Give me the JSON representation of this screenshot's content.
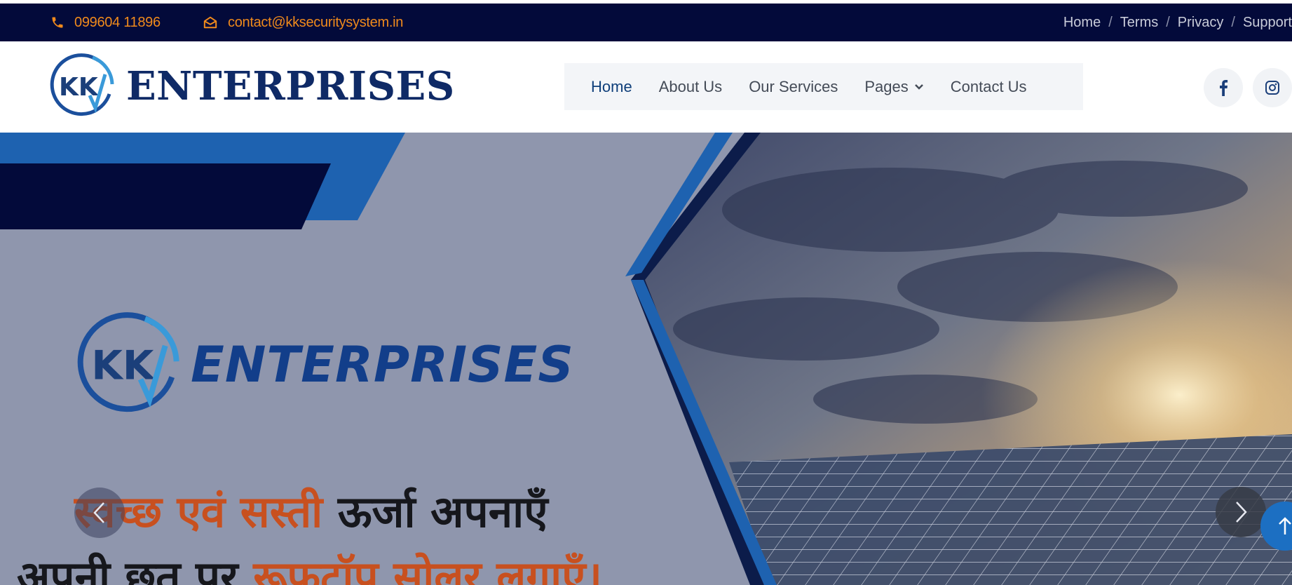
{
  "topbar": {
    "phone": "099604 11896",
    "email": "contact@kksecuritysystem.in",
    "links": [
      "Home",
      "Terms",
      "Privacy",
      "Support"
    ]
  },
  "header": {
    "logo_monogram": "KK",
    "brand": "ENTERPRISES",
    "nav": [
      {
        "label": "Home",
        "active": true
      },
      {
        "label": "About Us"
      },
      {
        "label": "Our Services"
      },
      {
        "label": "Pages",
        "has_dropdown": true
      },
      {
        "label": "Contact Us"
      }
    ],
    "social": [
      "facebook-icon",
      "instagram-icon"
    ]
  },
  "hero": {
    "brand": "ENTERPRISES",
    "tagline_line1_orange": "स्वच्छ एवं सस्ती",
    "tagline_line1_dark": "ऊर्जा अपनाएँ",
    "tagline_line2_dark": "अपनी छत पर",
    "tagline_line2_orange": "रूफटॉप सोलर लगाएँ।",
    "controls": [
      "chevron-left-icon",
      "chevron-right-icon",
      "arrow-up-icon"
    ]
  },
  "colors": {
    "topbar_bg": "#030a3a",
    "accent_orange": "#f08a1c",
    "brand_navy": "#0f2a66",
    "brand_blue": "#1c6fc2",
    "tagline_orange": "#c8501f"
  }
}
